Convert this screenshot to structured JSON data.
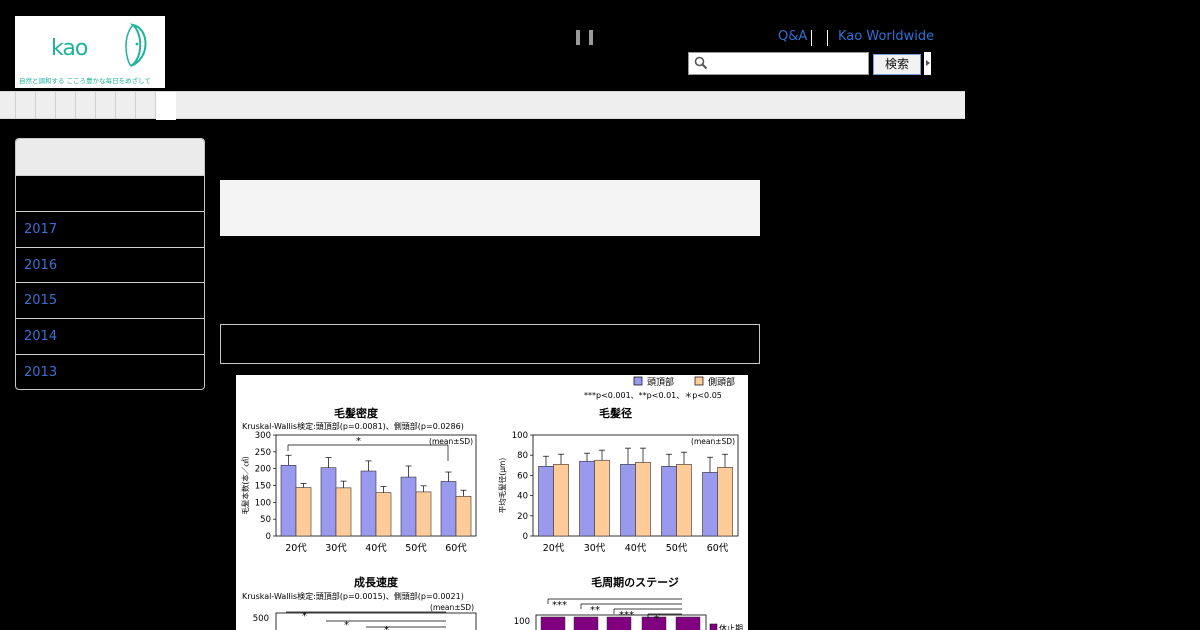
{
  "header": {
    "logo": {
      "wordmark": "kao",
      "tagline": "自然と調和する こころ豊かな毎日をめざして"
    },
    "util_links": [
      "Q&A",
      "Kao Worldwide"
    ],
    "search": {
      "placeholder": "",
      "button_label": "検索",
      "icon": "search-icon"
    }
  },
  "sidebar": {
    "years": [
      "2017",
      "2016",
      "2015",
      "2014",
      "2013"
    ]
  },
  "colors": {
    "brand": "#1fb39a",
    "link": "#2f6fd6",
    "crown": "#9999ee",
    "temporal": "#ffcc99",
    "telogen": "#800080"
  },
  "figure": {
    "legend": {
      "crown": "頭頂部",
      "temporal": "側頭部",
      "sig": "***p<0.001、**p<0.01、＊p<0.05"
    },
    "footer_legend": "休止期"
  },
  "chart_data": [
    {
      "type": "bar",
      "title": "毛髪密度",
      "subtitle": "Kruskal-Wallis検定:頭頂部(p=0.0081)、側頭部(p=0.0286)",
      "note": "(mean±SD)",
      "ylabel": "毛髪本数(本／㎠)",
      "categories": [
        "20代",
        "30代",
        "40代",
        "50代",
        "60代"
      ],
      "series": [
        {
          "name": "頭頂部",
          "values": [
            210,
            203,
            193,
            175,
            162
          ],
          "sd": [
            30,
            30,
            30,
            33,
            28
          ]
        },
        {
          "name": "側頭部",
          "values": [
            144,
            143,
            129,
            131,
            118
          ],
          "sd": [
            12,
            20,
            18,
            18,
            18
          ]
        }
      ],
      "ylim": [
        0,
        300
      ],
      "yticks": [
        0,
        50,
        100,
        150,
        200,
        250,
        300
      ],
      "significance": "*"
    },
    {
      "type": "bar",
      "title": "毛髪径",
      "note": "(mean±SD)",
      "ylabel": "平均毛髪径(μm)",
      "categories": [
        "20代",
        "30代",
        "40代",
        "50代",
        "60代"
      ],
      "series": [
        {
          "name": "頭頂部",
          "values": [
            69,
            74,
            71,
            69,
            63
          ],
          "sd": [
            10,
            8,
            16,
            12,
            15
          ]
        },
        {
          "name": "側頭部",
          "values": [
            71,
            75,
            73,
            71,
            68
          ],
          "sd": [
            10,
            10,
            14,
            12,
            13
          ]
        }
      ],
      "ylim": [
        0,
        100
      ],
      "yticks": [
        0,
        20,
        40,
        60,
        80,
        100
      ]
    },
    {
      "type": "bar",
      "title": "成長速度",
      "subtitle": "Kruskal-Wallis検定:頭頂部(p=0.0015)、側頭部(p=0.0021)",
      "note": "(mean±SD)",
      "yticks": [
        500
      ],
      "significance": "*"
    },
    {
      "type": "bar",
      "title": "毛周期のステージ",
      "yticks": [
        100
      ],
      "significance": [
        "***",
        "**",
        "***",
        "*"
      ],
      "legend": "休止期"
    }
  ]
}
